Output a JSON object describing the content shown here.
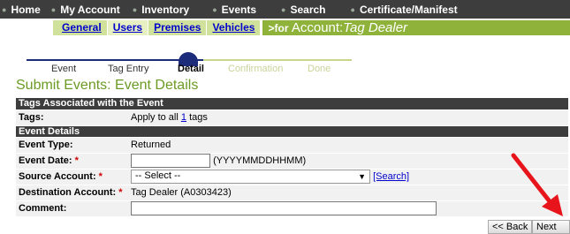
{
  "topnav": {
    "items": [
      "Home",
      "My Account",
      "Inventory",
      "Events",
      "Search",
      "Certificate/Manifest"
    ]
  },
  "subnav": {
    "tabs": [
      "General",
      "Users",
      "Premises",
      "Vehicles"
    ],
    "account_prefix": ">for",
    "account_label": "Account:",
    "account_name": "Tag Dealer"
  },
  "stepper": {
    "steps": [
      "Event",
      "Tag Entry",
      "Detail",
      "Confirmation",
      "Done"
    ],
    "current": "Detail"
  },
  "page_title": "Submit Events: Event Details",
  "sections": {
    "tags_header": "Tags Associated with the Event",
    "details_header": "Event Details"
  },
  "fields": {
    "tags_label": "Tags:",
    "tags_prefix": "Apply to all",
    "tags_count": "1",
    "tags_suffix": "tags",
    "event_type_label": "Event Type:",
    "event_type_value": "Returned",
    "event_date_label": "Event Date:",
    "event_date_hint": "(YYYYMMDDHHMM)",
    "source_account_label": "Source Account:",
    "source_account_selected": "-- Select --",
    "search_link": "[Search]",
    "destination_label": "Destination Account:",
    "destination_value": "Tag Dealer (A0303423)",
    "comment_label": "Comment:",
    "required_mark": "*"
  },
  "buttons": {
    "back": "<< Back",
    "next": "Next >>"
  },
  "colors": {
    "nav_bg": "#3d3d3d",
    "subnav_light": "#cfe19a",
    "subnav_dark": "#8fb23a",
    "title_green": "#6c9b25",
    "stepper_dark": "#1c2b7a",
    "annotation_arrow": "#e8141b"
  }
}
